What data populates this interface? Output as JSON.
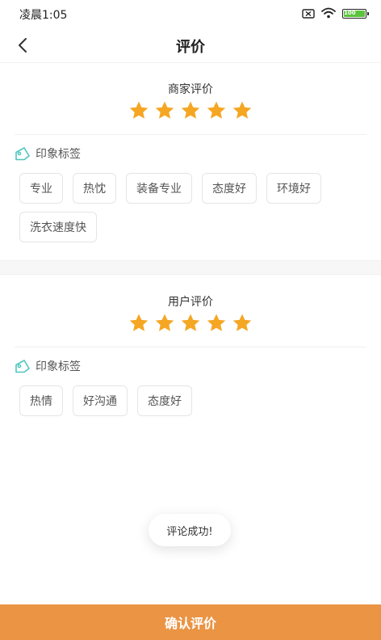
{
  "status_bar": {
    "time": "凌晨1:05",
    "icons": [
      "sim-off-icon",
      "wifi-icon",
      "battery-icon"
    ],
    "battery_text": "100"
  },
  "nav": {
    "back_icon": "chevron-left-icon",
    "title": "评价"
  },
  "merchant_review": {
    "title": "商家评价",
    "rating": 5,
    "max_rating": 5,
    "tag_header": "印象标签",
    "tags": [
      "专业",
      "热忱",
      "装备专业",
      "态度好",
      "环境好",
      "洗衣速度快"
    ]
  },
  "user_review": {
    "title": "用户评价",
    "rating": 5,
    "max_rating": 5,
    "tag_header": "印象标签",
    "tags": [
      "热情",
      "好沟通",
      "态度好"
    ]
  },
  "toast": {
    "text": "评论成功!"
  },
  "submit": {
    "label": "确认评价"
  },
  "colors": {
    "star": "#f5a623",
    "accent": "#ea9444",
    "tag_icon": "#4fc6c0",
    "battery": "#5cc33c"
  }
}
